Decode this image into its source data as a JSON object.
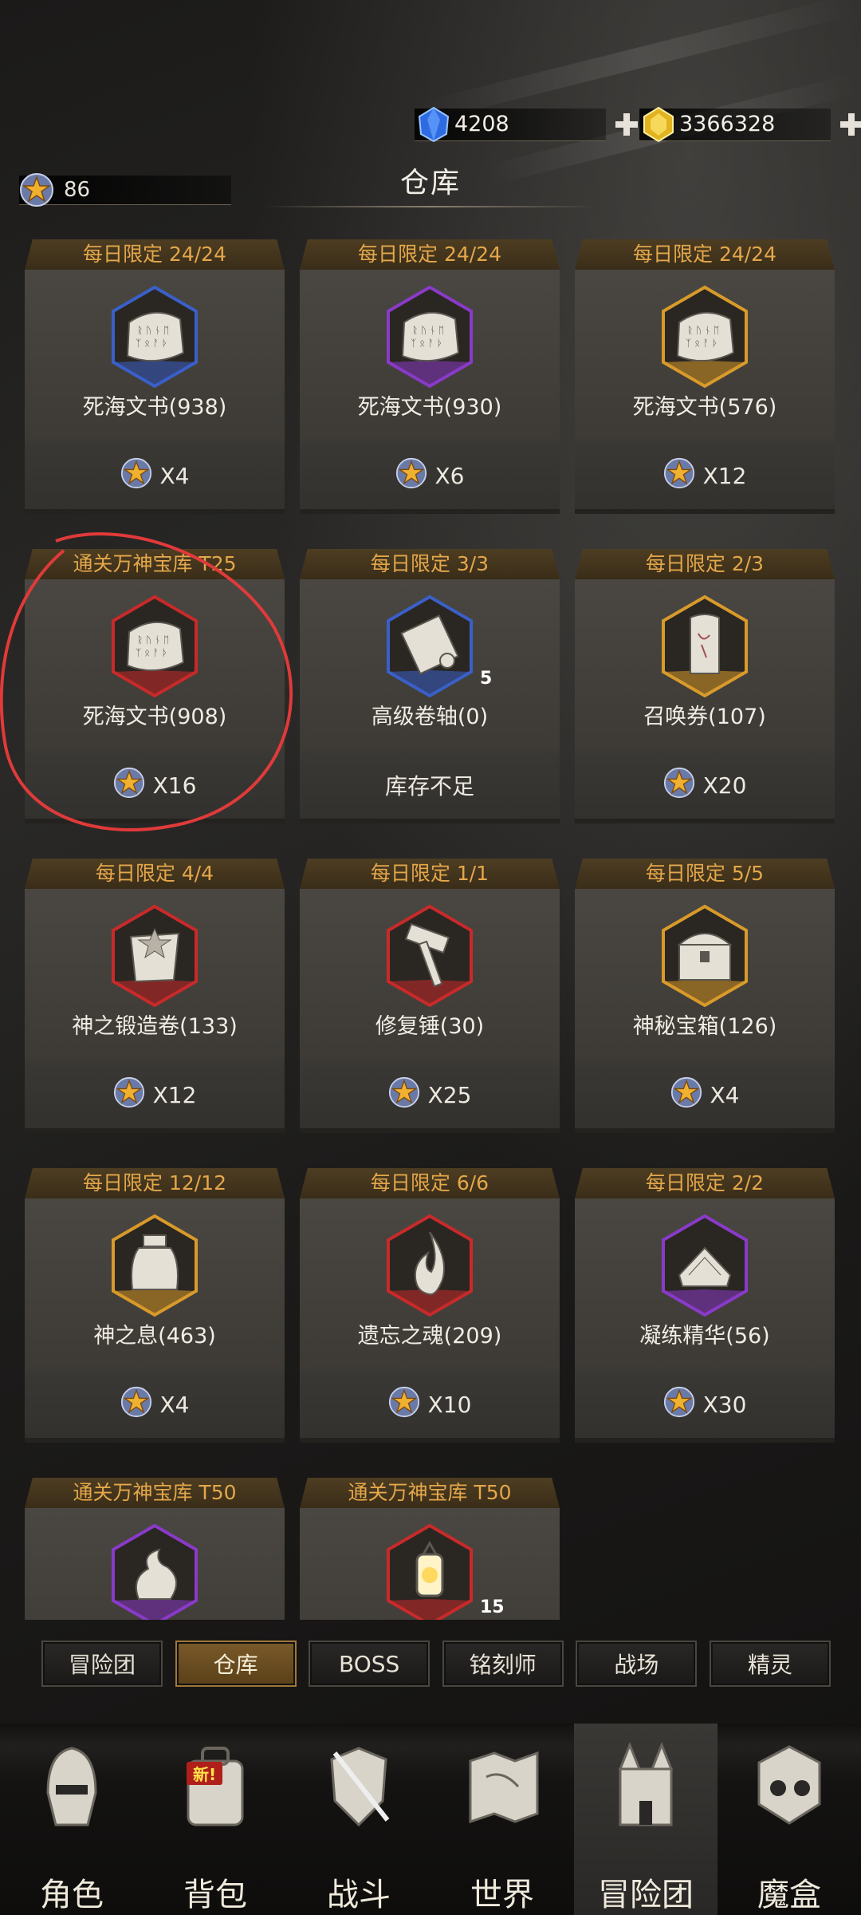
{
  "currency": {
    "gems": "4208",
    "gold": "3366328",
    "token": "86"
  },
  "page_title": "仓库",
  "items": [
    {
      "header": "每日限定 24/24",
      "name": "死海文书(938)",
      "price": "X4",
      "frame": "#3a60c8",
      "icon": "tablet"
    },
    {
      "header": "每日限定 24/24",
      "name": "死海文书(930)",
      "price": "X6",
      "frame": "#8a3ac8",
      "icon": "tablet"
    },
    {
      "header": "每日限定 24/24",
      "name": "死海文书(576)",
      "price": "X12",
      "frame": "#d89a2a",
      "icon": "tablet"
    },
    {
      "header": "通关万神宝库 T25",
      "name": "死海文书(908)",
      "price": "X16",
      "frame": "#c82a2a",
      "icon": "tablet"
    },
    {
      "header": "每日限定 3/3",
      "name": "高级卷轴(0)",
      "price": "库存不足",
      "frame": "#3a60c8",
      "icon": "scroll",
      "qty": "5"
    },
    {
      "header": "每日限定 2/3",
      "name": "召唤券(107)",
      "price": "X20",
      "frame": "#d89a2a",
      "icon": "ticket"
    },
    {
      "header": "每日限定 4/4",
      "name": "神之锻造卷(133)",
      "price": "X12",
      "frame": "#c82a2a",
      "icon": "forge"
    },
    {
      "header": "每日限定 1/1",
      "name": "修复锤(30)",
      "price": "X25",
      "frame": "#c82a2a",
      "icon": "hammer"
    },
    {
      "header": "每日限定 5/5",
      "name": "神秘宝箱(126)",
      "price": "X4",
      "frame": "#d89a2a",
      "icon": "chest"
    },
    {
      "header": "每日限定 12/12",
      "name": "神之息(463)",
      "price": "X4",
      "frame": "#d89a2a",
      "icon": "jar"
    },
    {
      "header": "每日限定 6/6",
      "name": "遗忘之魂(209)",
      "price": "X10",
      "frame": "#c82a2a",
      "icon": "flame"
    },
    {
      "header": "每日限定 2/2",
      "name": "凝练精华(56)",
      "price": "X30",
      "frame": "#8a3ac8",
      "icon": "essence"
    },
    {
      "header": "通关万神宝库 T50",
      "name": "",
      "price": "",
      "frame": "#8a3ac8",
      "icon": "spirit"
    },
    {
      "header": "通关万神宝库 T50",
      "name": "",
      "price": "",
      "frame": "#c82a2a",
      "icon": "lantern",
      "qty": "15"
    }
  ],
  "tabs": [
    "冒险团",
    "仓库",
    "BOSS",
    "铭刻师",
    "战场",
    "精灵"
  ],
  "active_tab": 1,
  "nav": [
    {
      "label": "角色",
      "icon": "helmet-icon"
    },
    {
      "label": "背包",
      "icon": "backpack-icon",
      "badge": "新!"
    },
    {
      "label": "战斗",
      "icon": "shield-swords-icon"
    },
    {
      "label": "世界",
      "icon": "map-icon"
    },
    {
      "label": "冒险团",
      "icon": "castle-icon"
    },
    {
      "label": "魔盒",
      "icon": "cube-icon"
    }
  ],
  "active_nav": 4,
  "colors": {
    "header_text": "#e4a74a",
    "annotation": "#e03a3a",
    "active_tab": "#7a5a2a"
  }
}
